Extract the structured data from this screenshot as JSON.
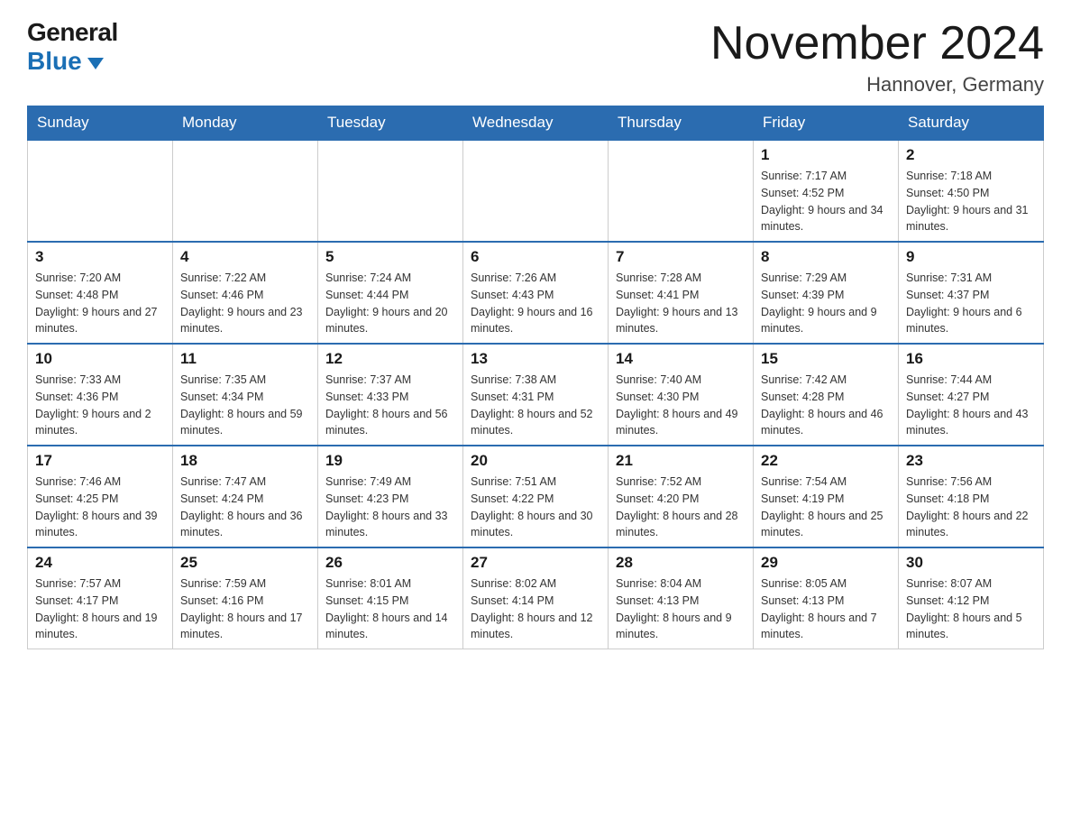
{
  "header": {
    "logo_line1": "General",
    "logo_line2": "Blue",
    "month_title": "November 2024",
    "location": "Hannover, Germany"
  },
  "days_of_week": [
    "Sunday",
    "Monday",
    "Tuesday",
    "Wednesday",
    "Thursday",
    "Friday",
    "Saturday"
  ],
  "weeks": [
    {
      "days": [
        {
          "number": "",
          "info": ""
        },
        {
          "number": "",
          "info": ""
        },
        {
          "number": "",
          "info": ""
        },
        {
          "number": "",
          "info": ""
        },
        {
          "number": "",
          "info": ""
        },
        {
          "number": "1",
          "info": "Sunrise: 7:17 AM\nSunset: 4:52 PM\nDaylight: 9 hours and 34 minutes."
        },
        {
          "number": "2",
          "info": "Sunrise: 7:18 AM\nSunset: 4:50 PM\nDaylight: 9 hours and 31 minutes."
        }
      ]
    },
    {
      "days": [
        {
          "number": "3",
          "info": "Sunrise: 7:20 AM\nSunset: 4:48 PM\nDaylight: 9 hours and 27 minutes."
        },
        {
          "number": "4",
          "info": "Sunrise: 7:22 AM\nSunset: 4:46 PM\nDaylight: 9 hours and 23 minutes."
        },
        {
          "number": "5",
          "info": "Sunrise: 7:24 AM\nSunset: 4:44 PM\nDaylight: 9 hours and 20 minutes."
        },
        {
          "number": "6",
          "info": "Sunrise: 7:26 AM\nSunset: 4:43 PM\nDaylight: 9 hours and 16 minutes."
        },
        {
          "number": "7",
          "info": "Sunrise: 7:28 AM\nSunset: 4:41 PM\nDaylight: 9 hours and 13 minutes."
        },
        {
          "number": "8",
          "info": "Sunrise: 7:29 AM\nSunset: 4:39 PM\nDaylight: 9 hours and 9 minutes."
        },
        {
          "number": "9",
          "info": "Sunrise: 7:31 AM\nSunset: 4:37 PM\nDaylight: 9 hours and 6 minutes."
        }
      ]
    },
    {
      "days": [
        {
          "number": "10",
          "info": "Sunrise: 7:33 AM\nSunset: 4:36 PM\nDaylight: 9 hours and 2 minutes."
        },
        {
          "number": "11",
          "info": "Sunrise: 7:35 AM\nSunset: 4:34 PM\nDaylight: 8 hours and 59 minutes."
        },
        {
          "number": "12",
          "info": "Sunrise: 7:37 AM\nSunset: 4:33 PM\nDaylight: 8 hours and 56 minutes."
        },
        {
          "number": "13",
          "info": "Sunrise: 7:38 AM\nSunset: 4:31 PM\nDaylight: 8 hours and 52 minutes."
        },
        {
          "number": "14",
          "info": "Sunrise: 7:40 AM\nSunset: 4:30 PM\nDaylight: 8 hours and 49 minutes."
        },
        {
          "number": "15",
          "info": "Sunrise: 7:42 AM\nSunset: 4:28 PM\nDaylight: 8 hours and 46 minutes."
        },
        {
          "number": "16",
          "info": "Sunrise: 7:44 AM\nSunset: 4:27 PM\nDaylight: 8 hours and 43 minutes."
        }
      ]
    },
    {
      "days": [
        {
          "number": "17",
          "info": "Sunrise: 7:46 AM\nSunset: 4:25 PM\nDaylight: 8 hours and 39 minutes."
        },
        {
          "number": "18",
          "info": "Sunrise: 7:47 AM\nSunset: 4:24 PM\nDaylight: 8 hours and 36 minutes."
        },
        {
          "number": "19",
          "info": "Sunrise: 7:49 AM\nSunset: 4:23 PM\nDaylight: 8 hours and 33 minutes."
        },
        {
          "number": "20",
          "info": "Sunrise: 7:51 AM\nSunset: 4:22 PM\nDaylight: 8 hours and 30 minutes."
        },
        {
          "number": "21",
          "info": "Sunrise: 7:52 AM\nSunset: 4:20 PM\nDaylight: 8 hours and 28 minutes."
        },
        {
          "number": "22",
          "info": "Sunrise: 7:54 AM\nSunset: 4:19 PM\nDaylight: 8 hours and 25 minutes."
        },
        {
          "number": "23",
          "info": "Sunrise: 7:56 AM\nSunset: 4:18 PM\nDaylight: 8 hours and 22 minutes."
        }
      ]
    },
    {
      "days": [
        {
          "number": "24",
          "info": "Sunrise: 7:57 AM\nSunset: 4:17 PM\nDaylight: 8 hours and 19 minutes."
        },
        {
          "number": "25",
          "info": "Sunrise: 7:59 AM\nSunset: 4:16 PM\nDaylight: 8 hours and 17 minutes."
        },
        {
          "number": "26",
          "info": "Sunrise: 8:01 AM\nSunset: 4:15 PM\nDaylight: 8 hours and 14 minutes."
        },
        {
          "number": "27",
          "info": "Sunrise: 8:02 AM\nSunset: 4:14 PM\nDaylight: 8 hours and 12 minutes."
        },
        {
          "number": "28",
          "info": "Sunrise: 8:04 AM\nSunset: 4:13 PM\nDaylight: 8 hours and 9 minutes."
        },
        {
          "number": "29",
          "info": "Sunrise: 8:05 AM\nSunset: 4:13 PM\nDaylight: 8 hours and 7 minutes."
        },
        {
          "number": "30",
          "info": "Sunrise: 8:07 AM\nSunset: 4:12 PM\nDaylight: 8 hours and 5 minutes."
        }
      ]
    }
  ]
}
